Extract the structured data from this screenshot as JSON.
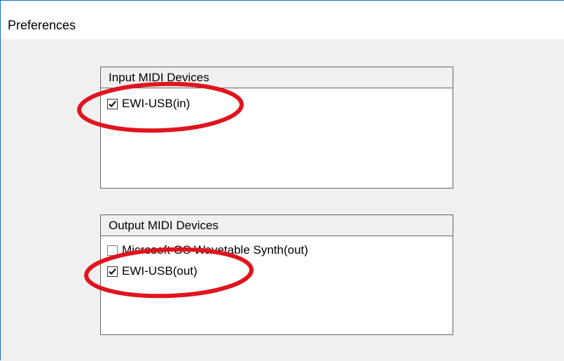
{
  "window": {
    "title": "Preferences"
  },
  "input_group": {
    "header": "Input MIDI Devices",
    "items": [
      {
        "label": "EWI-USB(in)",
        "checked": true
      }
    ]
  },
  "output_group": {
    "header": "Output MIDI Devices",
    "items": [
      {
        "label": "Microsoft GS Wavetable Synth(out)",
        "checked": false
      },
      {
        "label": "EWI-USB(out)",
        "checked": true
      }
    ]
  },
  "annotations": {
    "color": "#e0141e",
    "shape": "ellipse"
  },
  "colors": {
    "accent": "#1a6fd1",
    "panel_border": "#646464"
  }
}
